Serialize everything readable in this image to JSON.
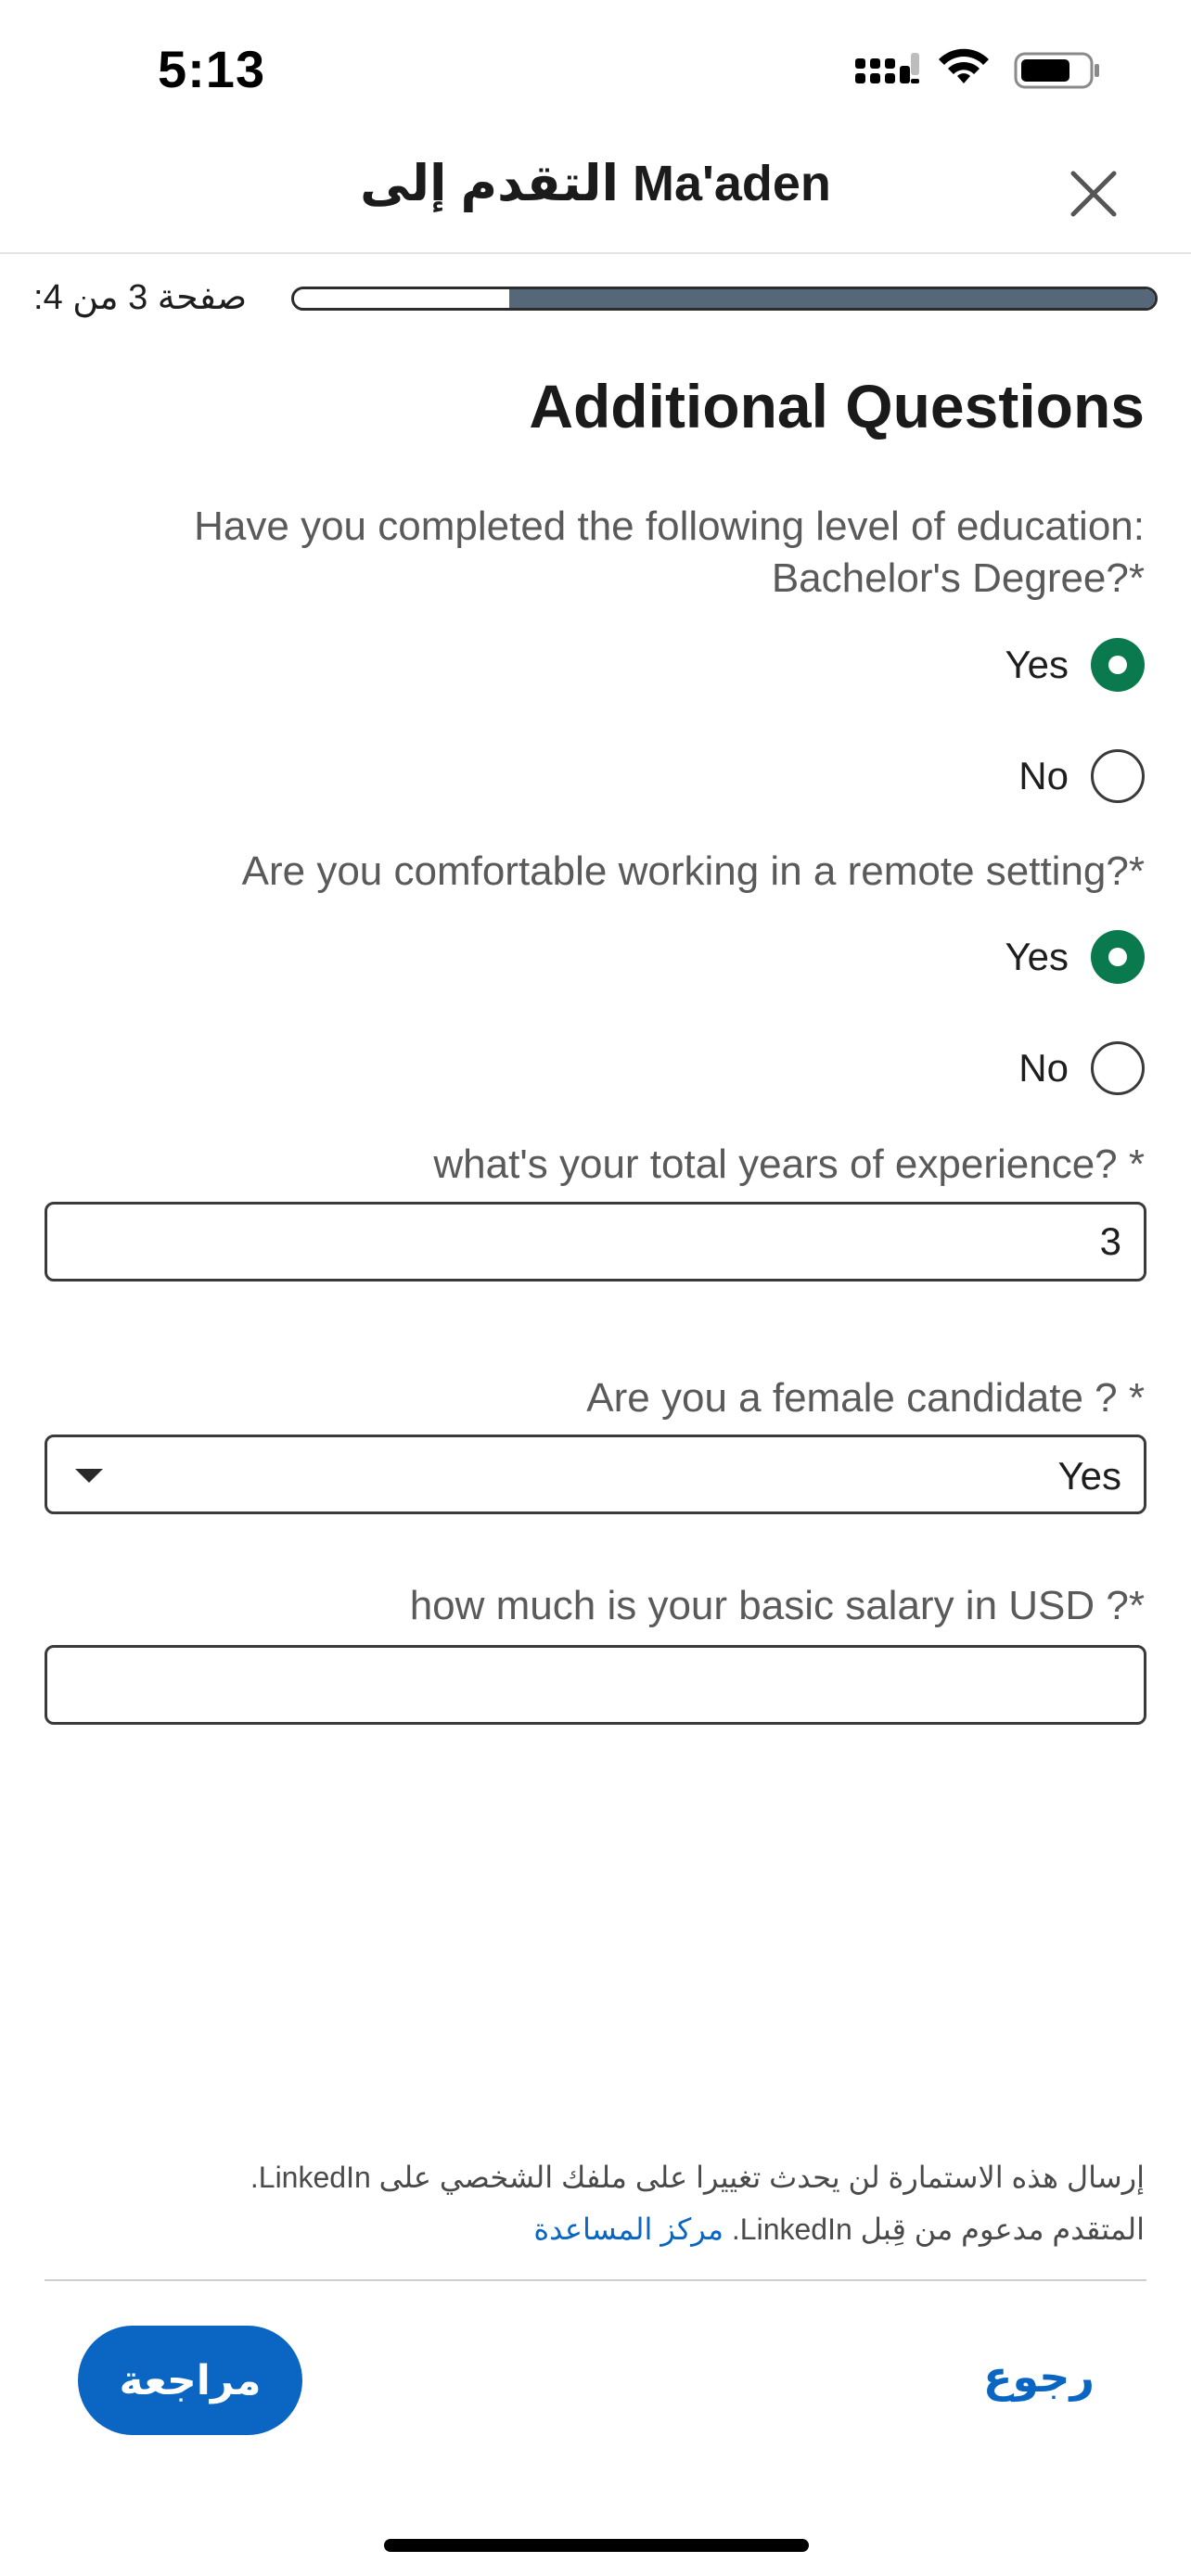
{
  "status_bar": {
    "time": "5:13"
  },
  "header": {
    "title": "التقدم إلى Ma'aden"
  },
  "progress": {
    "page_label": "صفحة 3 من 4:",
    "fraction": 0.75
  },
  "section_title": "Additional Questions",
  "questions": [
    {
      "label": "Have you completed the following level of education: Bachelor's Degree?*",
      "options": [
        "Yes",
        "No"
      ],
      "selected": "Yes"
    },
    {
      "label": "Are you comfortable working in a remote setting?*",
      "options": [
        "Yes",
        "No"
      ],
      "selected": "Yes"
    },
    {
      "label": "what's your total years of experience? *",
      "value": "3"
    },
    {
      "label": "Are you a female candidate ? *",
      "value": "Yes"
    },
    {
      "label": "how much is your basic salary in USD ?*",
      "value": ""
    }
  ],
  "footer": {
    "line1": "إرسال هذه الاستمارة لن يحدث تغييرا على ملفك الشخصي على LinkedIn.",
    "line2_prefix": "المتقدم مدعوم من قِبل LinkedIn.",
    "help_link": "مركز المساعدة"
  },
  "buttons": {
    "review": "مراجعة",
    "back": "رجوع"
  },
  "colors": {
    "accent": "#0a66c2",
    "radio_selected": "#0a7a4e",
    "progress_fill": "#56677a"
  }
}
